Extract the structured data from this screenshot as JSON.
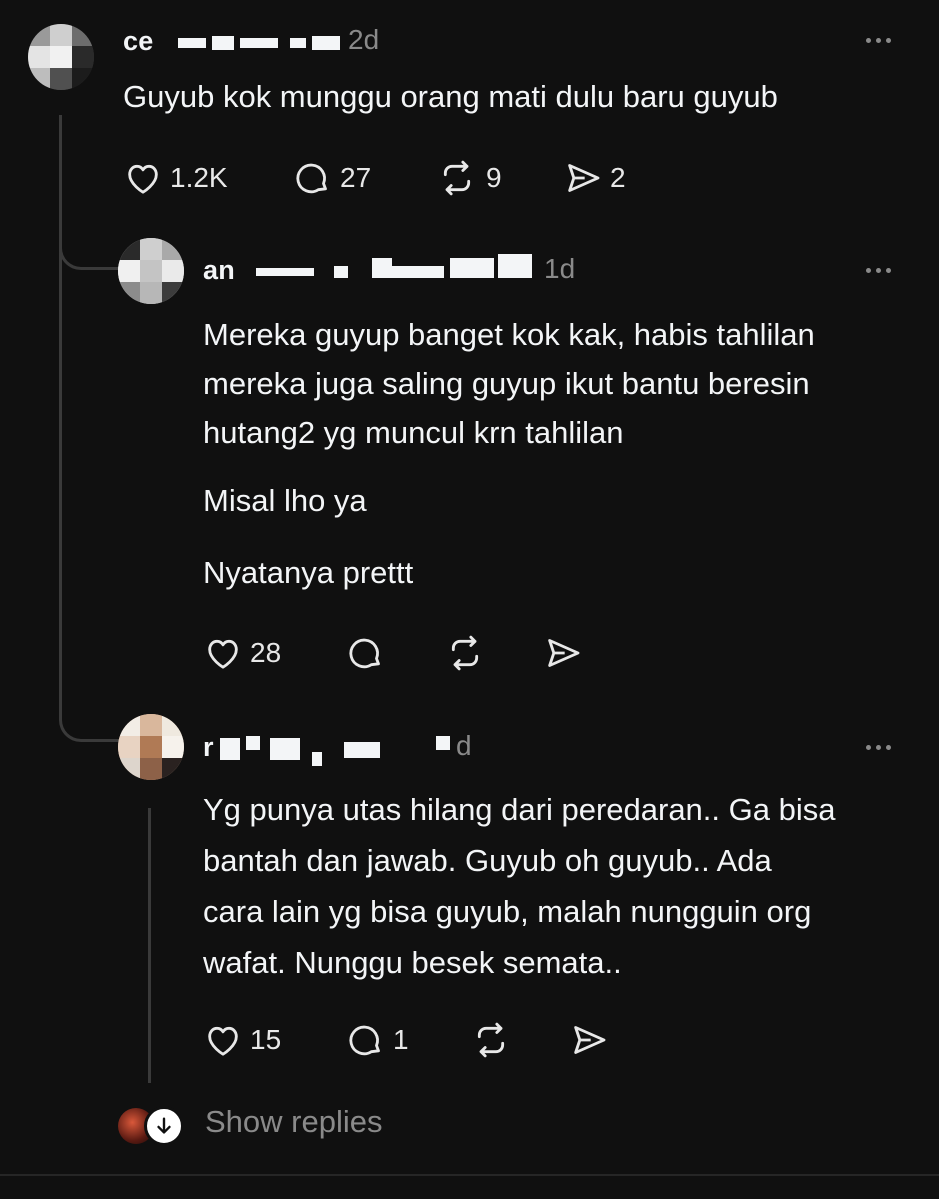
{
  "comments": [
    {
      "username": "ce",
      "time": "2d",
      "text": "Guyub kok munggu orang mati dulu baru guyub",
      "likes": "1.2K",
      "replies": "27",
      "reposts": "9",
      "shares": "2"
    },
    {
      "username": "an",
      "time": "1d",
      "paragraphs": [
        "Mereka guyup banget kok kak, habis tahlilan",
        "mereka juga saling guyup ikut bantu beresin",
        "hutang2 yg muncul krn tahlilan",
        "Misal lho ya",
        "Nyatanya prettt"
      ],
      "likes": "28"
    },
    {
      "username": "r",
      "time": "d",
      "lines": [
        "Yg punya utas hilang dari peredaran.. Ga bisa",
        "bantah dan jawab. Guyub oh guyub.. Ada",
        "cara lain yg bisa guyub, malah nungguin org",
        "wafat. Nunggu besek semata.."
      ],
      "likes": "15",
      "replies": "1"
    }
  ],
  "show_replies_label": "Show replies",
  "icons": [
    "heart-icon",
    "comment-icon",
    "repost-icon",
    "share-icon",
    "more-icon",
    "arrow-down-icon"
  ],
  "colors": {
    "background": "#101010",
    "text": "#f3f5f7",
    "muted": "#8a8a8a",
    "line": "#3a3a3a"
  }
}
